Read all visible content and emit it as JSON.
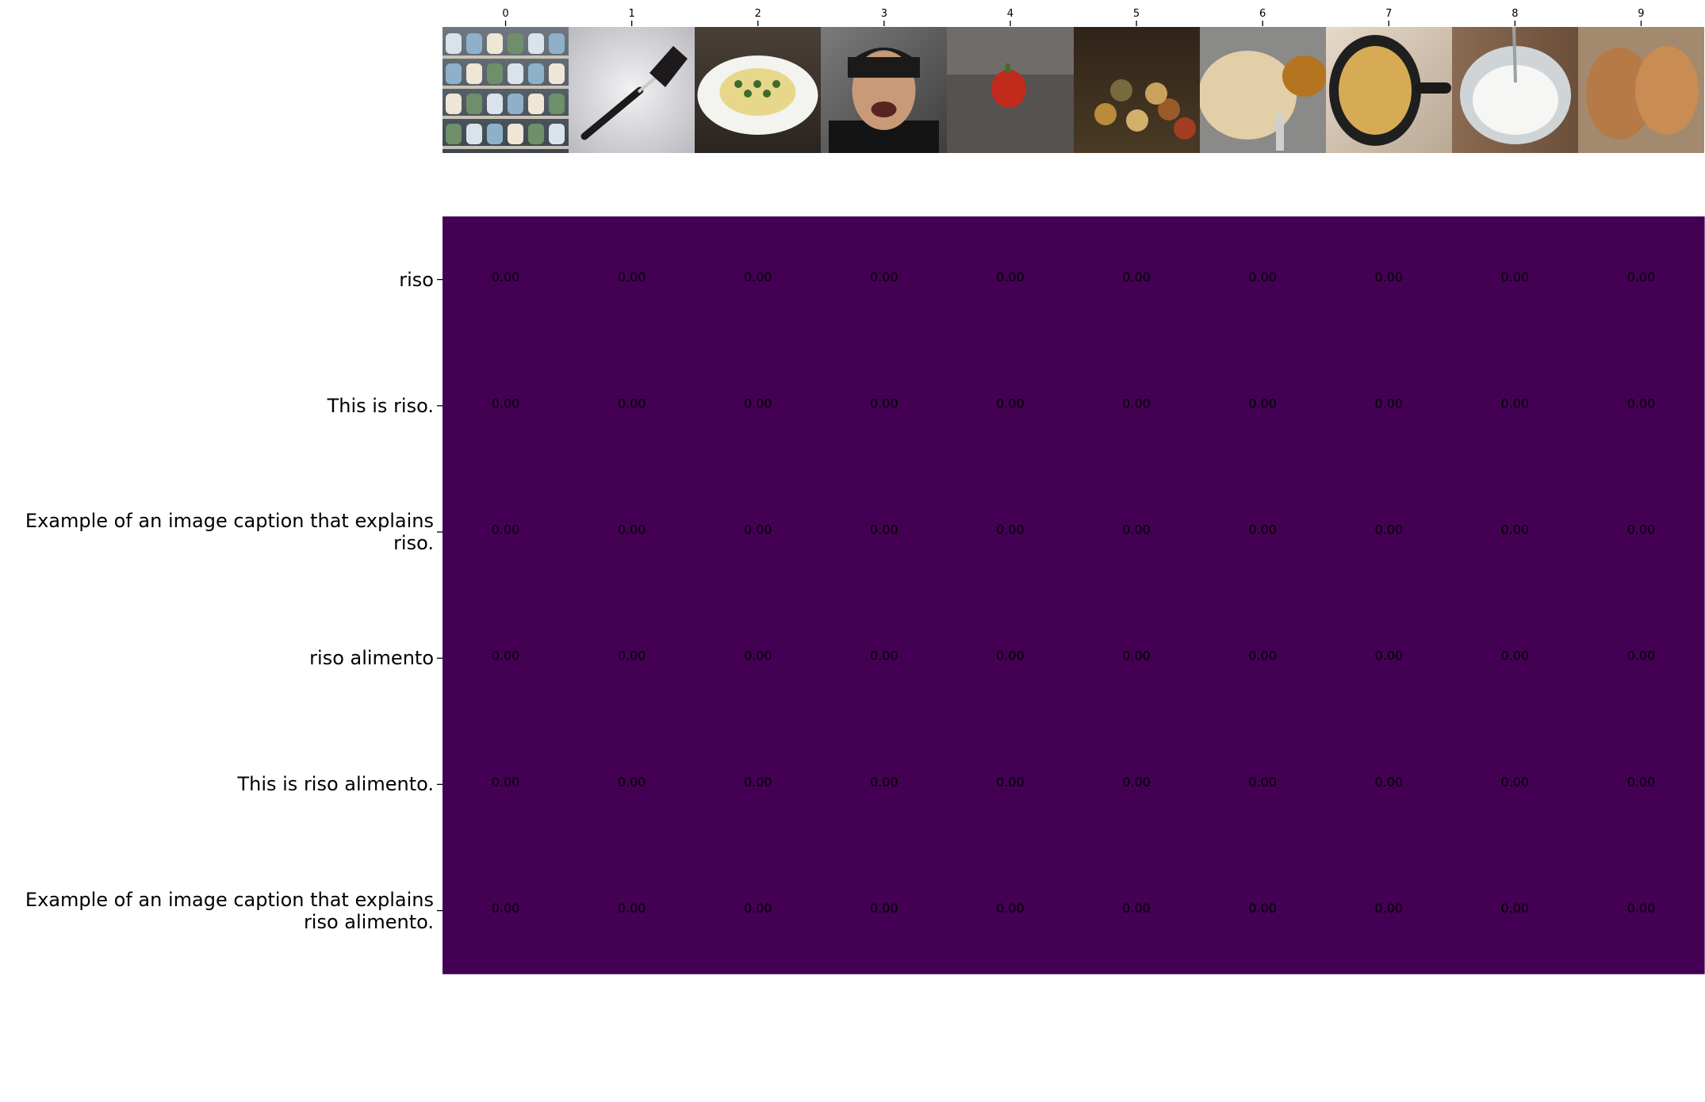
{
  "chart_data": {
    "type": "heatmap",
    "x_tick_labels": [
      "0",
      "1",
      "2",
      "3",
      "4",
      "5",
      "6",
      "7",
      "8",
      "9"
    ],
    "x_tick_images": [
      "grocery-shelf-photo",
      "spatula-photo",
      "pasta-plate-photo",
      "smiling-person-beanie-photo",
      "red-pepper-photo",
      "still-life-painting-photo",
      "flatbread-curry-photo",
      "pancake-in-pan-photo",
      "whipped-cream-whisk-photo",
      "bread-loaves-basket-photo"
    ],
    "y_tick_labels": [
      "riso",
      "This is riso.",
      "Example of an image caption that explains\nriso.",
      "riso alimento",
      "This is riso alimento.",
      "Example of an image caption that explains\nriso alimento."
    ],
    "values": [
      [
        0,
        0,
        0,
        0,
        0,
        0,
        0,
        0,
        0,
        0
      ],
      [
        0,
        0,
        0,
        0,
        0,
        0,
        0,
        0,
        0,
        0
      ],
      [
        0,
        0,
        0,
        0,
        0,
        0,
        0,
        0,
        0,
        0
      ],
      [
        0,
        0,
        0,
        0,
        0,
        0,
        0,
        0,
        0,
        0
      ],
      [
        0,
        0,
        0,
        0,
        0,
        0,
        0,
        0,
        0,
        0
      ],
      [
        0,
        0,
        0,
        0,
        0,
        0,
        0,
        0,
        0,
        0
      ]
    ],
    "cell_labels": [
      [
        "0.00",
        "0.00",
        "0.00",
        "0.00",
        "0.00",
        "0.00",
        "0.00",
        "0.00",
        "0.00",
        "0.00"
      ],
      [
        "0.00",
        "0.00",
        "0.00",
        "0.00",
        "0.00",
        "0.00",
        "0.00",
        "0.00",
        "0.00",
        "0.00"
      ],
      [
        "0.00",
        "0.00",
        "0.00",
        "0.00",
        "0.00",
        "0.00",
        "0.00",
        "0.00",
        "0.00",
        "0.00"
      ],
      [
        "0.00",
        "0.00",
        "0.00",
        "0.00",
        "0.00",
        "0.00",
        "0.00",
        "0.00",
        "0.00",
        "0.00"
      ],
      [
        "0.00",
        "0.00",
        "0.00",
        "0.00",
        "0.00",
        "0.00",
        "0.00",
        "0.00",
        "0.00",
        "0.00"
      ],
      [
        "0.00",
        "0.00",
        "0.00",
        "0.00",
        "0.00",
        "0.00",
        "0.00",
        "0.00",
        "0.00",
        "0.00"
      ]
    ],
    "colormap": "viridis",
    "cell_color": "#440154",
    "annotation_color": "#000000",
    "title": "",
    "xlabel": "",
    "ylabel": ""
  }
}
